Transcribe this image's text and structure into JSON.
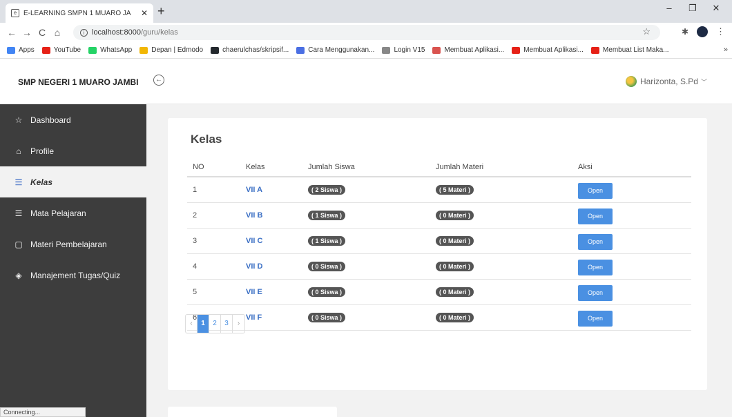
{
  "browser": {
    "tab_title": "E-LEARNING SMPN 1 MUARO JA",
    "url_host": "localhost:8000",
    "url_path": "/guru/kelas",
    "bookmarks": [
      {
        "label": "Apps",
        "color": "#4285f4"
      },
      {
        "label": "YouTube",
        "color": "#e62117"
      },
      {
        "label": "WhatsApp",
        "color": "#25d366"
      },
      {
        "label": "Depan | Edmodo",
        "color": "#f2b705"
      },
      {
        "label": "chaerulchas/skripsif...",
        "color": "#24292e"
      },
      {
        "label": "Cara Menggunakan...",
        "color": "#4a6fe3"
      },
      {
        "label": "Login V15",
        "color": "#888888"
      },
      {
        "label": "Membuat Aplikasi...",
        "color": "#d9534f"
      },
      {
        "label": "Membuat Aplikasi...",
        "color": "#e62117"
      },
      {
        "label": "Membuat List Maka...",
        "color": "#e62117"
      }
    ],
    "status": "Connecting..."
  },
  "header": {
    "brand": "SMP NEGERI 1 MUARO JAMBI",
    "user_name": "Harizonta, S.Pd"
  },
  "sidebar": {
    "items": [
      {
        "label": "Dashboard",
        "icon": "star-icon"
      },
      {
        "label": "Profile",
        "icon": "home-icon"
      },
      {
        "label": "Kelas",
        "icon": "database-icon"
      },
      {
        "label": "Mata Pelajaran",
        "icon": "database-icon"
      },
      {
        "label": "Materi Pembelajaran",
        "icon": "tablet-icon"
      },
      {
        "label": "Manajement Tugas/Quiz",
        "icon": "layers-icon"
      }
    ]
  },
  "main": {
    "title": "Kelas",
    "columns": [
      "NO",
      "Kelas",
      "Jumlah Siswa",
      "Jumlah Materi",
      "Aksi"
    ],
    "rows": [
      {
        "no": "1",
        "kelas": "VII A",
        "siswa": "( 2 Siswa )",
        "materi": "( 5 Materi )",
        "aksi": "Open"
      },
      {
        "no": "2",
        "kelas": "VII B",
        "siswa": "( 1 Siswa )",
        "materi": "( 0 Materi )",
        "aksi": "Open"
      },
      {
        "no": "3",
        "kelas": "VII C",
        "siswa": "( 1 Siswa )",
        "materi": "( 0 Materi )",
        "aksi": "Open"
      },
      {
        "no": "4",
        "kelas": "VII D",
        "siswa": "( 0 Siswa )",
        "materi": "( 0 Materi )",
        "aksi": "Open"
      },
      {
        "no": "5",
        "kelas": "VII E",
        "siswa": "( 0 Siswa )",
        "materi": "( 0 Materi )",
        "aksi": "Open"
      },
      {
        "no": "6",
        "kelas": "VII F",
        "siswa": "( 0 Siswa )",
        "materi": "( 0 Materi )",
        "aksi": "Open"
      }
    ],
    "pagination": {
      "prev": "‹",
      "pages": [
        "1",
        "2",
        "3"
      ],
      "next": "›",
      "current": "1"
    }
  },
  "colors": {
    "accent": "#4a90e2",
    "sidebar_bg": "#3d3d3d",
    "link": "#3b6fc4"
  }
}
